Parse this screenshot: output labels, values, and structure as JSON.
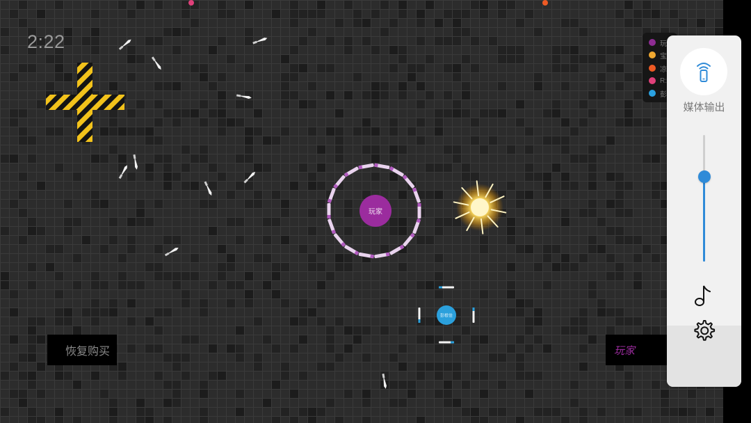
{
  "hud": {
    "timer": "2:22",
    "restore_purchase_label": "恢复购买",
    "player_tag_label": "玩家"
  },
  "leaderboard": [
    {
      "name": "玩",
      "color": "#8e2c93"
    },
    {
      "name": "宝",
      "color": "#f0a830"
    },
    {
      "name": "凉",
      "color": "#ee5a24"
    },
    {
      "name": "R:",
      "color": "#e0407a"
    },
    {
      "name": "彭",
      "color": "#2aa1e0"
    }
  ],
  "players": [
    {
      "label": "玩家",
      "color": "#9b2c9e"
    },
    {
      "label": "彭根佳",
      "color": "#2ba0dc"
    }
  ],
  "hazard": {
    "type": "striped-cross",
    "colors": [
      "#f2c21b",
      "#111111"
    ]
  },
  "powerup": {
    "type": "sun",
    "color": "#ffe066"
  },
  "edge_markers": [
    {
      "color": "#e0407a"
    },
    {
      "color": "#ee5a24"
    }
  ],
  "media_panel": {
    "cast_icon": "phone-cast-icon",
    "cast_label": "媒体输出",
    "volume_level": 0.67,
    "music_icon": "music-note-icon",
    "settings_icon": "gear-icon",
    "accent": "#2f8bd8"
  }
}
